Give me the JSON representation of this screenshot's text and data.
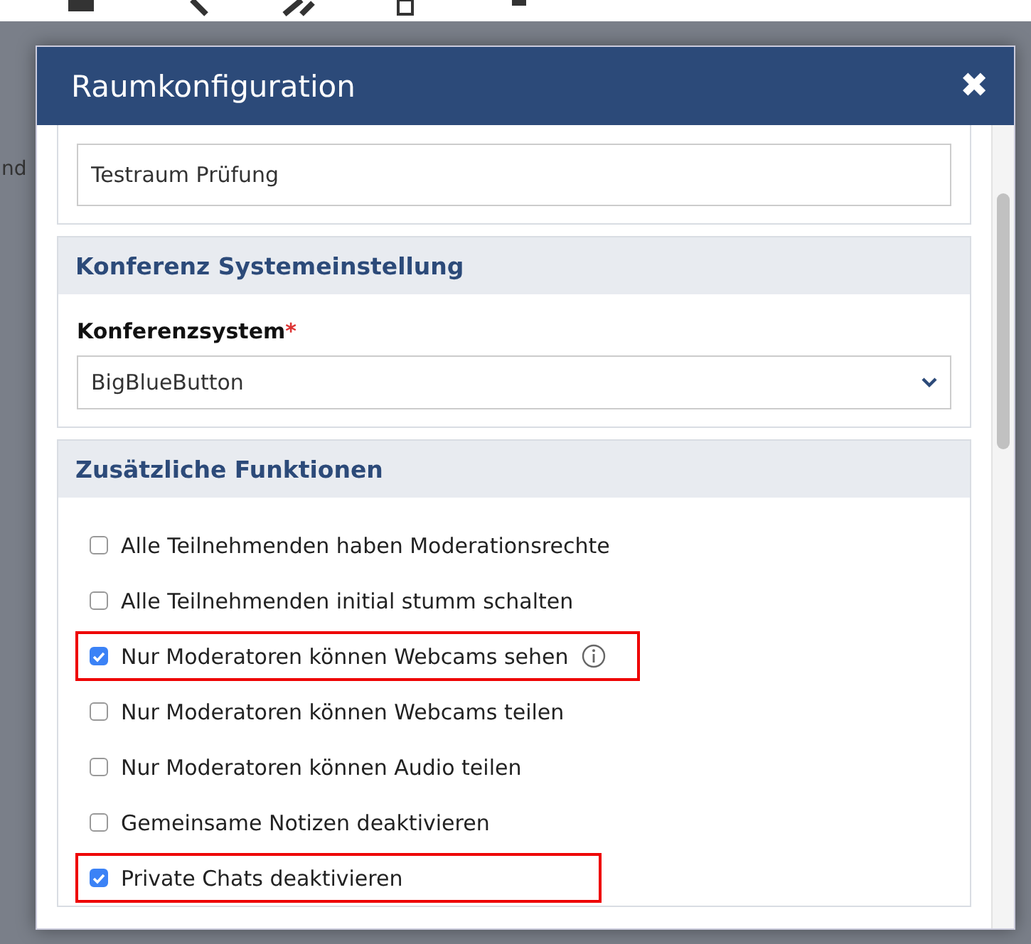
{
  "backdrop": {
    "text": "nd"
  },
  "dialog": {
    "title": "Raumkonfiguration",
    "close": "✖"
  },
  "name_field": {
    "value": "Testraum Prüfung"
  },
  "conference_section": {
    "title": "Konferenz Systemeinstellung",
    "field_label": "Konferenzsystem",
    "required_mark": "*",
    "select_value": "BigBlueButton"
  },
  "functions_section": {
    "title": "Zusätzliche Funktionen",
    "options": [
      {
        "label": "Alle Teilnehmenden haben Moderationsrechte",
        "checked": false,
        "highlighted": false,
        "info": false
      },
      {
        "label": "Alle Teilnehmenden initial stumm schalten",
        "checked": false,
        "highlighted": false,
        "info": false
      },
      {
        "label": "Nur Moderatoren können Webcams sehen",
        "checked": true,
        "highlighted": true,
        "info": true
      },
      {
        "label": "Nur Moderatoren können Webcams teilen",
        "checked": false,
        "highlighted": false,
        "info": false
      },
      {
        "label": "Nur Moderatoren können Audio teilen",
        "checked": false,
        "highlighted": false,
        "info": false
      },
      {
        "label": "Gemeinsame Notizen deaktivieren",
        "checked": false,
        "highlighted": false,
        "info": false
      },
      {
        "label": "Private Chats deaktivieren",
        "checked": true,
        "highlighted": true,
        "info": false
      }
    ]
  }
}
